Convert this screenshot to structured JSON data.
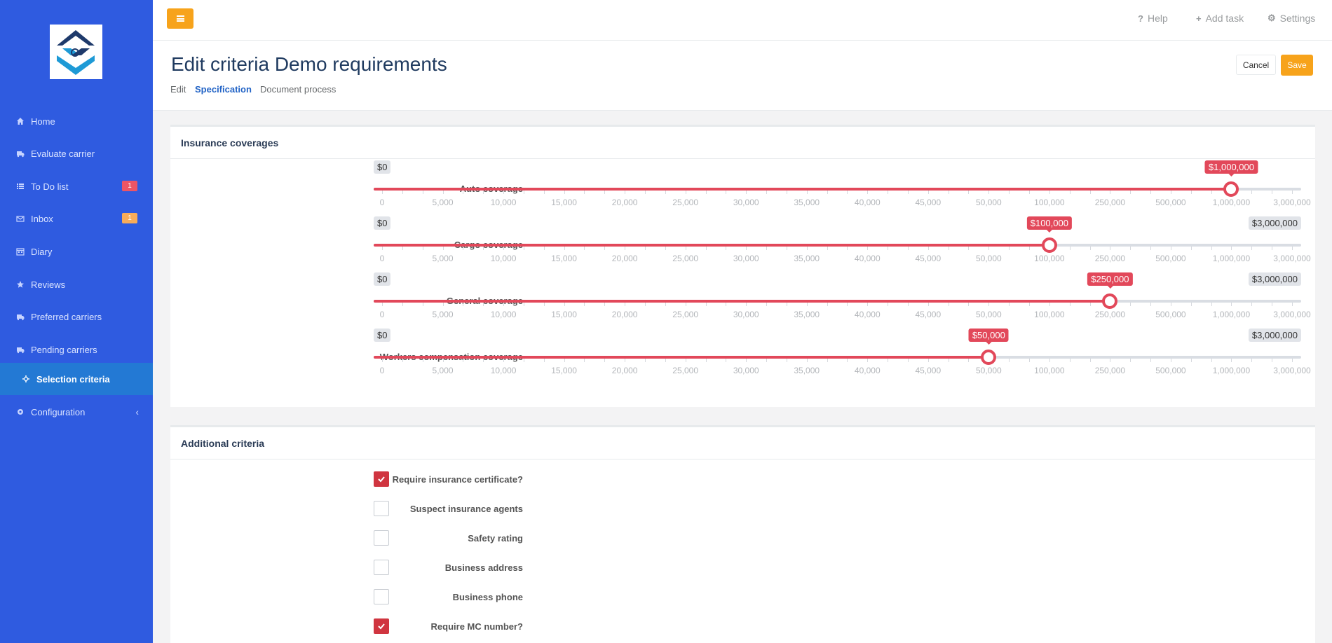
{
  "app": {
    "colors": {
      "sidebar": "#2f5be0",
      "active_nav": "#2379d4",
      "accent": "#f7a31b",
      "slider": "#e2485a",
      "badge_red": "#ed5565",
      "badge_orange": "#f8ac59"
    }
  },
  "sidebar": {
    "items": [
      {
        "label": "Home",
        "icon": "home-icon"
      },
      {
        "label": "Evaluate carrier",
        "icon": "truck-icon"
      },
      {
        "label": "To Do list",
        "icon": "list-icon",
        "badge": "1"
      },
      {
        "label": "Inbox",
        "icon": "envelope-icon",
        "badge": "1"
      },
      {
        "label": "Diary",
        "icon": "calendar-icon"
      },
      {
        "label": "Reviews",
        "icon": "star-icon"
      },
      {
        "label": "Preferred carriers",
        "icon": "truck-icon"
      },
      {
        "label": "Pending carriers",
        "icon": "truck-icon"
      },
      {
        "label": "Selection criteria",
        "icon": "crosshair-icon"
      },
      {
        "label": "Configuration",
        "icon": "gear-icon"
      }
    ]
  },
  "topbar": {
    "help": "Help",
    "add_task": "Add task",
    "settings": "Settings"
  },
  "heading": {
    "title": "Edit criteria Demo requirements",
    "tabs": [
      "Edit",
      "Specification",
      "Document process"
    ],
    "cancel": "Cancel",
    "save": "Save"
  },
  "coverages": {
    "title": "Insurance coverages",
    "scale": [
      "0",
      "5,000",
      "10,000",
      "15,000",
      "20,000",
      "25,000",
      "30,000",
      "35,000",
      "40,000",
      "45,000",
      "50,000",
      "100,000",
      "250,000",
      "500,000",
      "1,000,000",
      "3,000,000"
    ],
    "sliders": [
      {
        "label": "Auto coverage",
        "min": "$0",
        "max": "",
        "value": "$1,000,000",
        "index": 14
      },
      {
        "label": "Cargo coverage",
        "min": "$0",
        "max": "$3,000,000",
        "value": "$100,000",
        "index": 11
      },
      {
        "label": "General coverage",
        "min": "$0",
        "max": "$3,000,000",
        "value": "$250,000",
        "index": 12
      },
      {
        "label": "Workers compensation coverage",
        "min": "$0",
        "max": "$3,000,000",
        "value": "$50,000",
        "index": 10
      }
    ]
  },
  "additional": {
    "title": "Additional criteria",
    "items": [
      {
        "label": "Require insurance certificate?",
        "checked": true
      },
      {
        "label": "Suspect insurance agents",
        "checked": false
      },
      {
        "label": "Safety rating",
        "checked": false
      },
      {
        "label": "Business address",
        "checked": false
      },
      {
        "label": "Business phone",
        "checked": false
      },
      {
        "label": "Require MC number?",
        "checked": true
      }
    ]
  }
}
